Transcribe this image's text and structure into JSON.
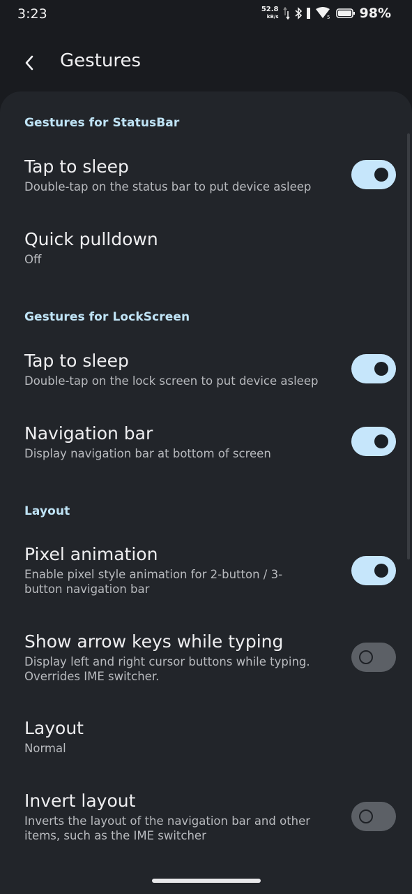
{
  "status_bar": {
    "time": "3:23",
    "net_speed": "52.8",
    "net_unit": "kB/s",
    "battery_percent": "98%",
    "icons": [
      "data-arrows-icon",
      "bluetooth-icon",
      "vibrate-icon",
      "wifi-icon",
      "battery-icon"
    ]
  },
  "app_bar": {
    "title": "Gestures",
    "back_icon": "back-arrow-icon"
  },
  "sections": {
    "statusbar": {
      "header": "Gestures for StatusBar",
      "tap_to_sleep": {
        "title": "Tap to sleep",
        "summary": "Double-tap on the status bar to put device asleep",
        "enabled": true
      },
      "quick_pulldown": {
        "title": "Quick pulldown",
        "summary": "Off"
      }
    },
    "lockscreen": {
      "header": "Gestures for LockScreen",
      "tap_to_sleep": {
        "title": "Tap to sleep",
        "summary": "Double-tap on the lock screen to put device asleep",
        "enabled": true
      },
      "navigation_bar": {
        "title": "Navigation bar",
        "summary": "Display navigation bar at bottom of screen",
        "enabled": true
      }
    },
    "layout": {
      "header": "Layout",
      "pixel_animation": {
        "title": "Pixel animation",
        "summary": "Enable pixel style animation for 2-button / 3-button navigation bar",
        "enabled": true
      },
      "arrow_keys": {
        "title": "Show arrow keys while typing",
        "summary": "Display left and right cursor buttons while typing. Overrides IME switcher.",
        "enabled": false
      },
      "layout_choice": {
        "title": "Layout",
        "summary": "Normal"
      },
      "invert_layout": {
        "title": "Invert layout",
        "summary": "Inverts the layout of the navigation bar and other items, such as the IME switcher",
        "enabled": false
      }
    }
  },
  "colors": {
    "background": "#191b1f",
    "card": "#22252a",
    "accent": "#c6e6fb",
    "section_header": "#bfe3f5"
  }
}
